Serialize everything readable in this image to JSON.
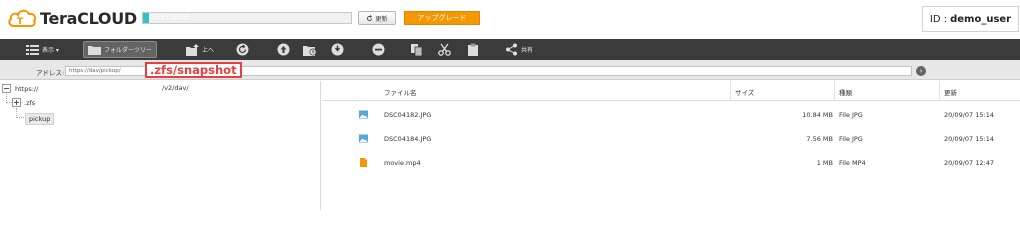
{
  "app": {
    "logo_text": "TeraCLOUD"
  },
  "header": {
    "quota_text": "0 GB / 10 GB",
    "quota_fraction": 0.03,
    "refresh_label": "更新",
    "upgrade_label": "アップグレード",
    "user_prefix": "ID :",
    "user_name": "demo_user"
  },
  "toolbar": {
    "view_label": "表示 ▾",
    "folder_tree_label": "フォルダーツリー",
    "up_label": "上へ",
    "share_label": "共有",
    "icons": [
      "list-icon",
      "folder-tree-icon",
      "folder-up-icon",
      "refresh-circle-icon",
      "upload-icon",
      "new-folder-icon",
      "download-icon",
      "delete-icon",
      "copy-icon",
      "cut-icon",
      "paste-icon",
      "share-icon"
    ]
  },
  "address": {
    "label": "アドレス:",
    "value": "https://dav/pickup/",
    "highlight": ".zfs/snapshot"
  },
  "tree": {
    "root_label": "https://",
    "root_path": "/v2/dav/",
    "items": [
      {
        "label": ".zfs"
      },
      {
        "label": "pickup"
      }
    ]
  },
  "list": {
    "columns": {
      "name": "ファイル名",
      "size": "サイズ",
      "type": "種類",
      "modified": "更新"
    },
    "files": [
      {
        "name": "DSC04182.JPG",
        "size": "10.84 MB",
        "type": "File JPG",
        "modified": "20/09/07 15:14",
        "icon": "image-file-icon"
      },
      {
        "name": "DSC04184.JPG",
        "size": "7.56 MB",
        "type": "File JPG",
        "modified": "20/09/07 15:14",
        "icon": "image-file-icon"
      },
      {
        "name": "movie.mp4",
        "size": "1 MB",
        "type": "File MP4",
        "modified": "20/09/07 12:47",
        "icon": "video-file-icon"
      }
    ]
  },
  "colors": {
    "accent": "#f39800",
    "quota_fill": "#33c2c6",
    "toolbar_bg": "#3b3b3b",
    "highlight": "#e8413d"
  }
}
